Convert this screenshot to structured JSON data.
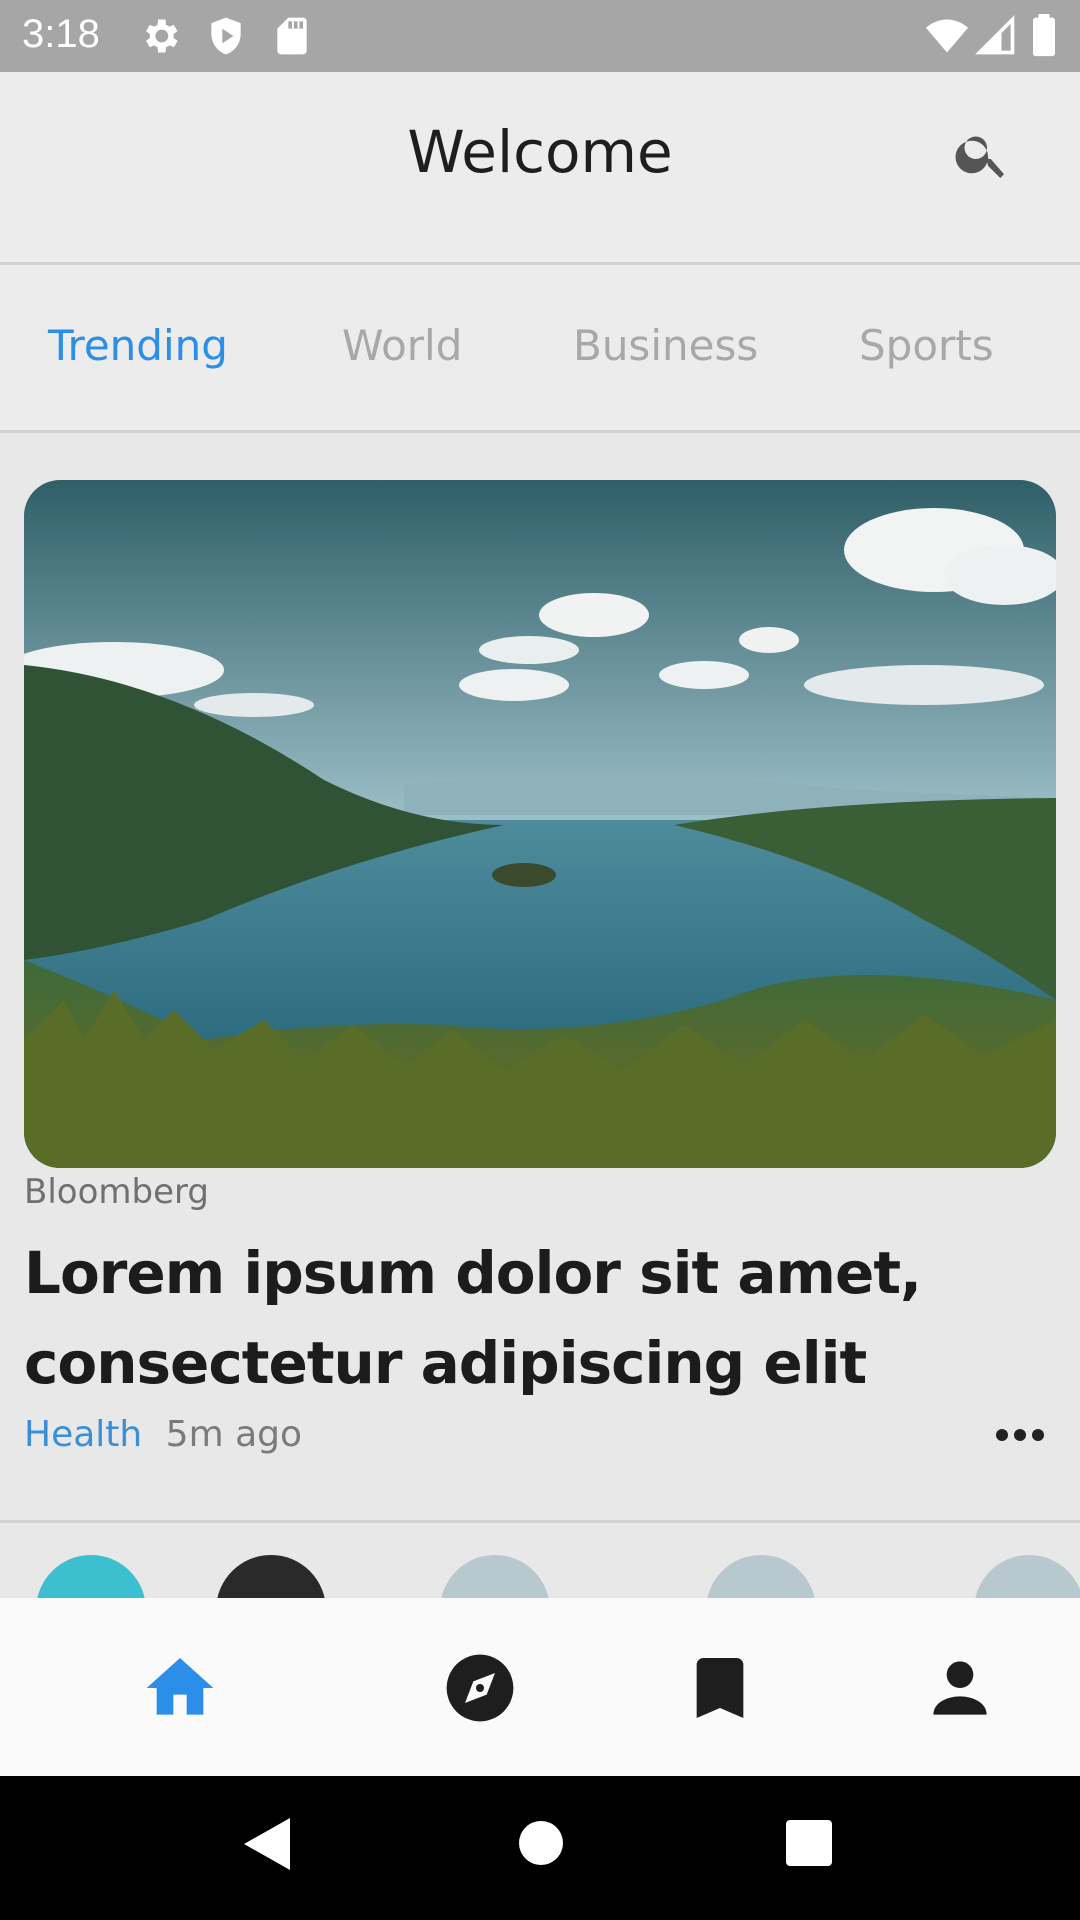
{
  "status_bar": {
    "time": "3:18",
    "left_icons": [
      "gear-icon",
      "shield-play-icon",
      "sd-card-icon"
    ],
    "right_icons": [
      "wifi-icon",
      "signal-icon",
      "battery-icon"
    ]
  },
  "header": {
    "title": "Welcome",
    "search_icon": "search-icon"
  },
  "tabs": [
    {
      "label": "Trending",
      "active": true
    },
    {
      "label": "World",
      "active": false
    },
    {
      "label": "Business",
      "active": false
    },
    {
      "label": "Sports",
      "active": false
    }
  ],
  "article": {
    "source": "Bloomberg",
    "headline": "Lorem ipsum dolor sit amet, consectetur adipiscing elit",
    "category": "Health",
    "time_ago": "5m ago",
    "more_icon": "more-horizontal-icon"
  },
  "bottom_nav": [
    {
      "icon": "home-icon",
      "active": true
    },
    {
      "icon": "compass-icon",
      "active": false
    },
    {
      "icon": "bookmark-icon",
      "active": false
    },
    {
      "icon": "person-icon",
      "active": false
    }
  ],
  "colors": {
    "accent": "#2b8ee8",
    "inactive_tab": "#a8a8a8",
    "nav_icon": "#1e1e1e"
  }
}
